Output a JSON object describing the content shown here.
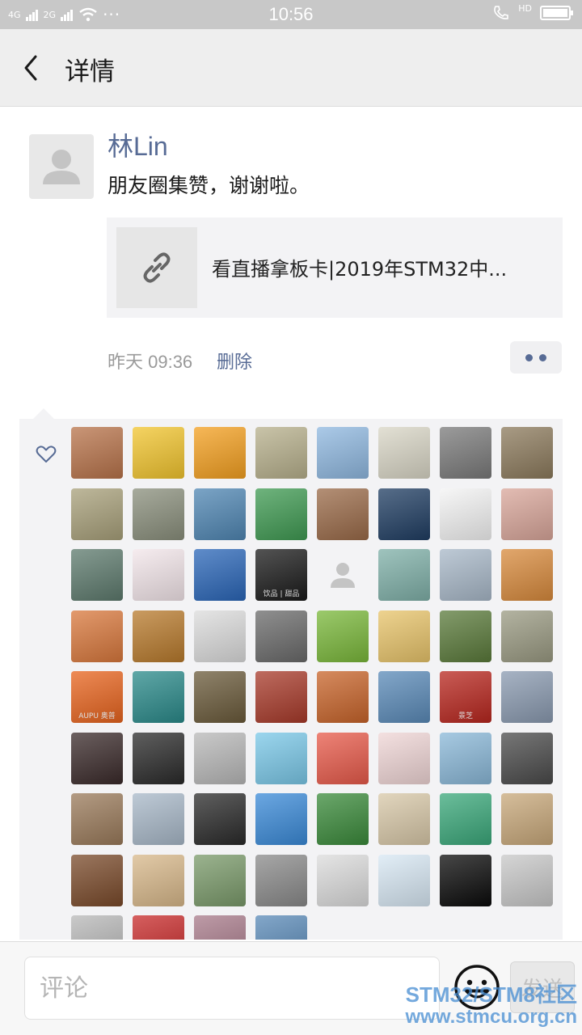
{
  "status_bar": {
    "net1": "4G",
    "net2": "2G",
    "more": "···",
    "time": "10:56",
    "hd": "HD"
  },
  "header": {
    "title": "详情"
  },
  "post": {
    "username": "林Lin",
    "text": "朋友圈集赞，谢谢啦。",
    "link_title": "看直播拿板卡|2019年STM32中...",
    "time": "昨天 09:36",
    "delete_label": "删除"
  },
  "likes": [
    {
      "icon": "kids-photo",
      "color": "#b8734a"
    },
    {
      "icon": "cartoon-duck",
      "color": "#f2c52e"
    },
    {
      "icon": "oranges",
      "color": "#f4a020"
    },
    {
      "icon": "sleeping-girl",
      "color": "#b7b08c"
    },
    {
      "icon": "winter-house",
      "color": "#8fb8e0"
    },
    {
      "icon": "girl-silhouette",
      "color": "#d9d6c6"
    },
    {
      "icon": "girl-black-hair",
      "color": "#7a7a7a"
    },
    {
      "icon": "toddler-playing",
      "color": "#8c7a5c"
    },
    {
      "icon": "kitten",
      "color": "#a8a07a"
    },
    {
      "icon": "park-path",
      "color": "#8a8f7c"
    },
    {
      "icon": "sea-horizon",
      "color": "#4f86b3"
    },
    {
      "icon": "pink-flowers",
      "color": "#3f9a52"
    },
    {
      "icon": "man-portrait",
      "color": "#9a6a48"
    },
    {
      "icon": "night-bridge",
      "color": "#1f3d62"
    },
    {
      "icon": "cartoon-boy",
      "color": "#f4f4f4"
    },
    {
      "icon": "baby-cat-ears",
      "color": "#d9a69a"
    },
    {
      "icon": "lake-scene",
      "color": "#5d7a6d"
    },
    {
      "icon": "cartoon-girl",
      "color": "#f3e6ea"
    },
    {
      "icon": "snow-mountain",
      "color": "#2a66b8"
    },
    {
      "icon": "gold-logo",
      "color": "#1a1a1a",
      "label": "饮品 | 甜品"
    },
    {
      "icon": "default-avatar",
      "color": "#f3f3f5",
      "placeholder": true
    },
    {
      "icon": "anime-girl",
      "color": "#7fb0a8"
    },
    {
      "icon": "wedding-photo",
      "color": "#a8b8c8"
    },
    {
      "icon": "shiba-dog",
      "color": "#d88a3c"
    },
    {
      "icon": "sunset-painting",
      "color": "#d9783c"
    },
    {
      "icon": "teddy-bear",
      "color": "#b87a2c"
    },
    {
      "icon": "girl-bw",
      "color": "#dcdcdc"
    },
    {
      "icon": "white-suv",
      "color": "#6a6a6a"
    },
    {
      "icon": "red-leaf",
      "color": "#7ab83a"
    },
    {
      "icon": "sailor-moon",
      "color": "#e8c46a"
    },
    {
      "icon": "pink-roses",
      "color": "#5a7a3a"
    },
    {
      "icon": "tabby-cat",
      "color": "#9a9a82"
    },
    {
      "icon": "aupu-logo",
      "color": "#e8641e",
      "label": "AUPU 奥普"
    },
    {
      "icon": "mountain-art",
      "color": "#2a8a8a"
    },
    {
      "icon": "woman-red",
      "color": "#6a5a3a"
    },
    {
      "icon": "shop-front",
      "color": "#a83a2a"
    },
    {
      "icon": "clay-pot",
      "color": "#c8642a"
    },
    {
      "icon": "blue-landscape",
      "color": "#5a8ab8"
    },
    {
      "icon": "jingzhi-logo",
      "color": "#b8261e",
      "label": "景芝"
    },
    {
      "icon": "man-selfie",
      "color": "#8a9ab0"
    },
    {
      "icon": "woman-dark",
      "color": "#3a2a2a"
    },
    {
      "icon": "woman-rose",
      "color": "#2a2a2a"
    },
    {
      "icon": "grey-cat",
      "color": "#b8b8b8"
    },
    {
      "icon": "sky-balloons",
      "color": "#7ac8e8"
    },
    {
      "icon": "maruko",
      "color": "#e85a4a"
    },
    {
      "icon": "red-papercut",
      "color": "#f0d6d6"
    },
    {
      "icon": "whale-art",
      "color": "#8ab8d8"
    },
    {
      "icon": "man-bw",
      "color": "#4a4a4a"
    },
    {
      "icon": "boy-cap",
      "color": "#9a7a5a"
    },
    {
      "icon": "red-sculpture",
      "color": "#a8b8c8"
    },
    {
      "icon": "dark-interior",
      "color": "#2a2a2a"
    },
    {
      "icon": "doraemon",
      "color": "#3a8ad8"
    },
    {
      "icon": "red-berries",
      "color": "#3a8a3a"
    },
    {
      "icon": "plush-bear",
      "color": "#d8c8a8"
    },
    {
      "icon": "girl-green",
      "color": "#3aa87a"
    },
    {
      "icon": "child-sand",
      "color": "#c8a87a"
    },
    {
      "icon": "child-face",
      "color": "#7a4a2a"
    },
    {
      "icon": "tea-set",
      "color": "#d8b88a"
    },
    {
      "icon": "man-suit",
      "color": "#7a9a6a"
    },
    {
      "icon": "husky-dog",
      "color": "#8a8a8a"
    },
    {
      "icon": "ink-horse",
      "color": "#dcdcdc"
    },
    {
      "icon": "sketch-boy",
      "color": "#d8e8f4"
    },
    {
      "icon": "black-square",
      "color": "#0a0a0a"
    },
    {
      "icon": "sports-car",
      "color": "#c8c8c8"
    },
    {
      "icon": "building-sky",
      "color": "#b8b8b8"
    },
    {
      "icon": "red-cartoon",
      "color": "#c82a2a"
    },
    {
      "icon": "crowd-photo",
      "color": "#a87a8a"
    },
    {
      "icon": "blue-photo",
      "color": "#5a8ab8"
    }
  ],
  "comment": {
    "placeholder": "评论",
    "send_label": "发送"
  },
  "watermark": {
    "line1": "STM32/STM8社区",
    "line2": "www.stmcu.org.cn"
  }
}
